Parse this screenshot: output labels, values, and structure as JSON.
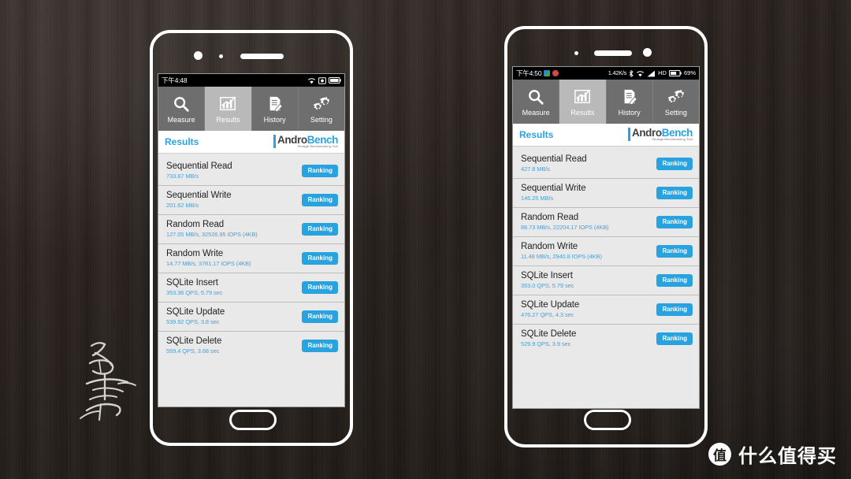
{
  "scene": {
    "background": "#2b2420",
    "accent": "#29a3e0"
  },
  "phones": [
    {
      "id": "left-phone",
      "status_bar": {
        "clock": "下午4:48",
        "network": "",
        "battery_pct": "",
        "icons": [
          "wifi-icon",
          "sdcard-icon",
          "battery-icon"
        ]
      },
      "tabs": [
        {
          "label": "Measure",
          "icon": "magnifier-icon",
          "active": false
        },
        {
          "label": "Results",
          "icon": "bar-chart-icon",
          "active": true
        },
        {
          "label": "History",
          "icon": "document-pencil-icon",
          "active": false
        },
        {
          "label": "Setting",
          "icon": "gears-icon",
          "active": false
        }
      ],
      "header": {
        "title": "Results",
        "logo_primary": "Andro",
        "logo_secondary": "Bench",
        "logo_tagline": "Storage Benchmarking Tool"
      },
      "results": [
        {
          "title": "Sequential Read",
          "value": "733.67 MB/s",
          "button": "Ranking"
        },
        {
          "title": "Sequential Write",
          "value": "201.62 MB/s",
          "button": "Ranking"
        },
        {
          "title": "Random Read",
          "value": "127.05 MB/s, 32526.95 IOPS (4KB)",
          "button": "Ranking"
        },
        {
          "title": "Random Write",
          "value": "14.77 MB/s, 3781.17 IOPS (4KB)",
          "button": "Ranking"
        },
        {
          "title": "SQLite Insert",
          "value": "353.36 QPS, 5.79 sec",
          "button": "Ranking"
        },
        {
          "title": "SQLite Update",
          "value": "539.92 QPS, 3.8 sec",
          "button": "Ranking"
        },
        {
          "title": "SQLite Delete",
          "value": "559.4 QPS, 3.68 sec",
          "button": "Ranking"
        }
      ]
    },
    {
      "id": "right-phone",
      "status_bar": {
        "clock": "下午4:50",
        "network": "1.42K/s",
        "battery_pct": "69%",
        "hd_label": "HD",
        "icons": [
          "app-badge-icon",
          "alarm-badge-icon",
          "bluetooth-icon",
          "wifi-icon",
          "signal-icon",
          "hd-icon",
          "battery-icon"
        ]
      },
      "tabs": [
        {
          "label": "Measure",
          "icon": "magnifier-icon",
          "active": false
        },
        {
          "label": "Results",
          "icon": "bar-chart-icon",
          "active": true
        },
        {
          "label": "History",
          "icon": "document-pencil-icon",
          "active": false
        },
        {
          "label": "Setting",
          "icon": "gears-icon",
          "active": false
        }
      ],
      "header": {
        "title": "Results",
        "logo_primary": "Andro",
        "logo_secondary": "Bench",
        "logo_tagline": "Storage Benchmarking Tool"
      },
      "results": [
        {
          "title": "Sequential Read",
          "value": "427.8 MB/s",
          "button": "Ranking"
        },
        {
          "title": "Sequential Write",
          "value": "146.25 MB/s",
          "button": "Ranking"
        },
        {
          "title": "Random Read",
          "value": "86.73 MB/s, 22204.17 IOPS (4KB)",
          "button": "Ranking"
        },
        {
          "title": "Random Write",
          "value": "11.48 MB/s, 2940.8 IOPS (4KB)",
          "button": "Ranking"
        },
        {
          "title": "SQLite Insert",
          "value": "353.0 QPS, 5.79 sec",
          "button": "Ranking"
        },
        {
          "title": "SQLite Update",
          "value": "476.27 QPS, 4.3 sec",
          "button": "Ranking"
        },
        {
          "title": "SQLite Delete",
          "value": "529.9 QPS, 3.9 sec",
          "button": "Ranking"
        }
      ]
    }
  ],
  "watermarks": {
    "signature": "handwritten-chinese-signature",
    "brand_badge": "值",
    "brand_text": "什么值得买"
  }
}
